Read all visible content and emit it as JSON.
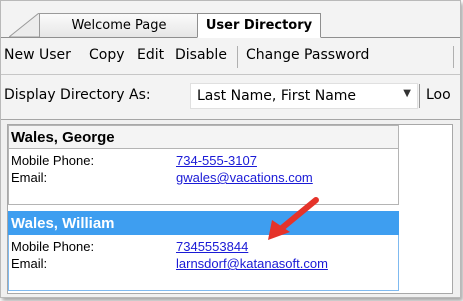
{
  "tabs": [
    {
      "label": "Welcome Page"
    },
    {
      "label": "User Directory"
    }
  ],
  "toolbar": {
    "new_user": "New User",
    "copy": "Copy",
    "edit": "Edit",
    "disable": "Disable",
    "change_password": "Change Password"
  },
  "directory": {
    "label": "Display Directory As:",
    "selected": "Last Name, First Name",
    "extra": "Loo"
  },
  "users": [
    {
      "name": "Wales, George",
      "mobile_label": "Mobile Phone:",
      "mobile": "734-555-3107",
      "email_label": "Email:",
      "email": "gwales@vacations.com"
    },
    {
      "name": "Wales, William",
      "mobile_label": "Mobile Phone:",
      "mobile": "7345553844",
      "email_label": "Email:",
      "email": "larnsdorf@katanasoft.com"
    }
  ],
  "colors": {
    "selected_row": "#3e9ef0",
    "link": "#1a1ad6",
    "annotation_arrow": "#e5332a"
  },
  "icons": [
    "dropdown-caret-icon",
    "annotation-arrow-icon"
  ]
}
